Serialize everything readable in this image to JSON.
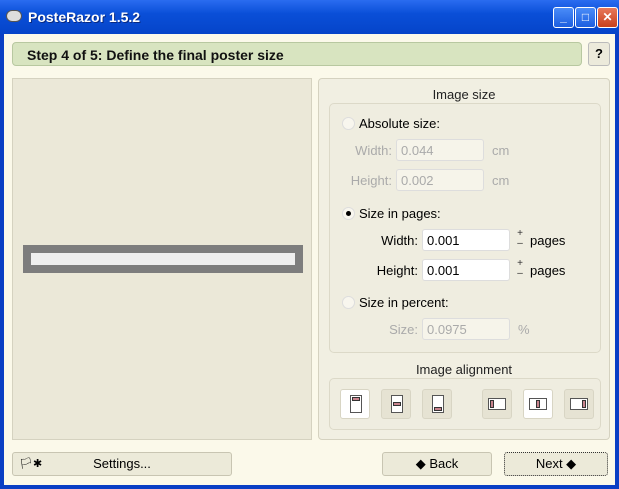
{
  "window": {
    "title": "PosteRazor 1.5.2"
  },
  "step": {
    "title": "Step 4 of 5: Define the final poster size",
    "help": "?"
  },
  "image_size": {
    "title": "Image size",
    "absolute": {
      "label": "Absolute size:",
      "width_label": "Width:",
      "width": "0.044",
      "height_label": "Height:",
      "height": "0.002",
      "unit": "cm"
    },
    "pages": {
      "label": "Size in pages:",
      "width_label": "Width:",
      "width": "0.001",
      "height_label": "Height:",
      "height": "0.001",
      "unit": "pages",
      "selected": true
    },
    "percent": {
      "label": "Size in percent:",
      "size_label": "Size:",
      "size": "0.0975",
      "unit": "%"
    }
  },
  "alignment": {
    "title": "Image alignment"
  },
  "buttons": {
    "settings": "Settings...",
    "back": "Back",
    "next": "Next"
  }
}
